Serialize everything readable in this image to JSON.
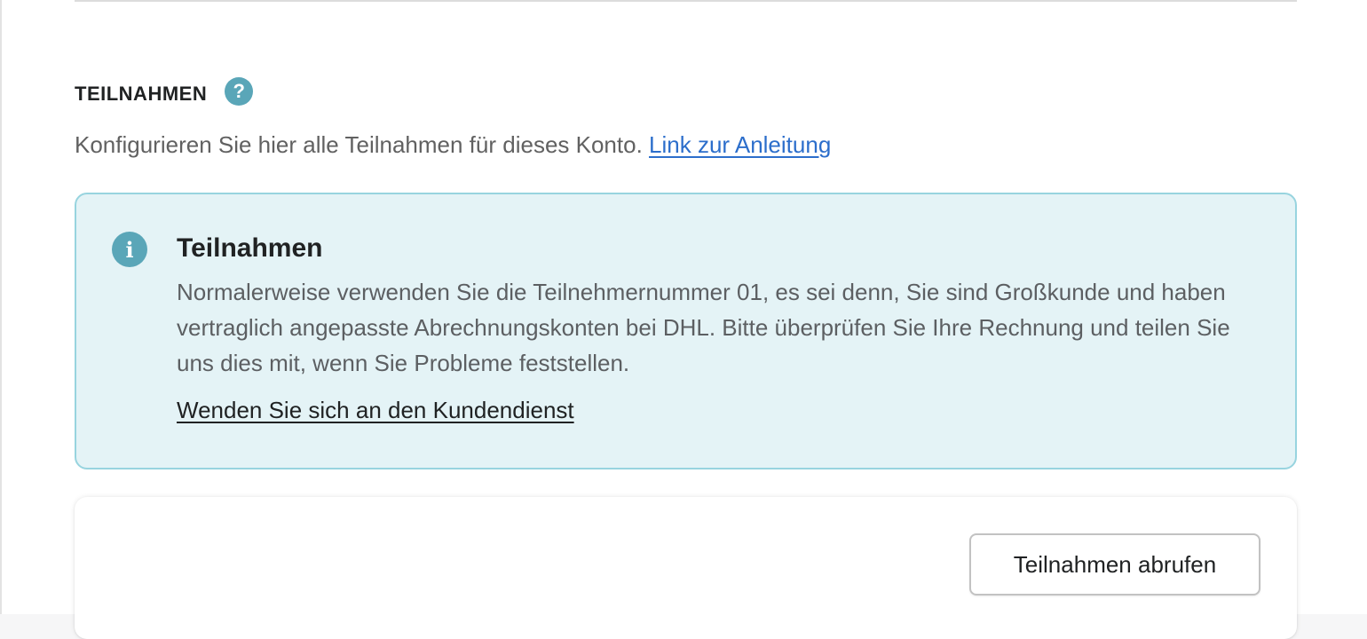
{
  "section": {
    "title": "TEILNAHMEN",
    "help_icon": "question-circle-icon",
    "description_text": "Konfigurieren Sie hier alle Teilnahmen für dieses Konto. ",
    "guide_link": "Link zur Anleitung"
  },
  "banner": {
    "icon": "info-icon",
    "title": "Teilnahmen",
    "body": "Normalerweise verwenden Sie die Teilnehmernummer 01, es sei denn, Sie sind Großkunde und haben vertraglich angepasste Abrechnungskonten bei DHL. Bitte überprüfen Sie Ihre Rechnung und teilen Sie uns dies mit, wenn Sie Probleme feststellen.",
    "support_link": "Wenden Sie sich an den Kundendienst"
  },
  "card": {
    "fetch_button_label": "Teilnahmen abrufen"
  },
  "colors": {
    "accent": "#5aa6b8",
    "link": "#2c6ecb",
    "banner_bg": "#e4f3f6",
    "banner_border": "#98d4df"
  }
}
